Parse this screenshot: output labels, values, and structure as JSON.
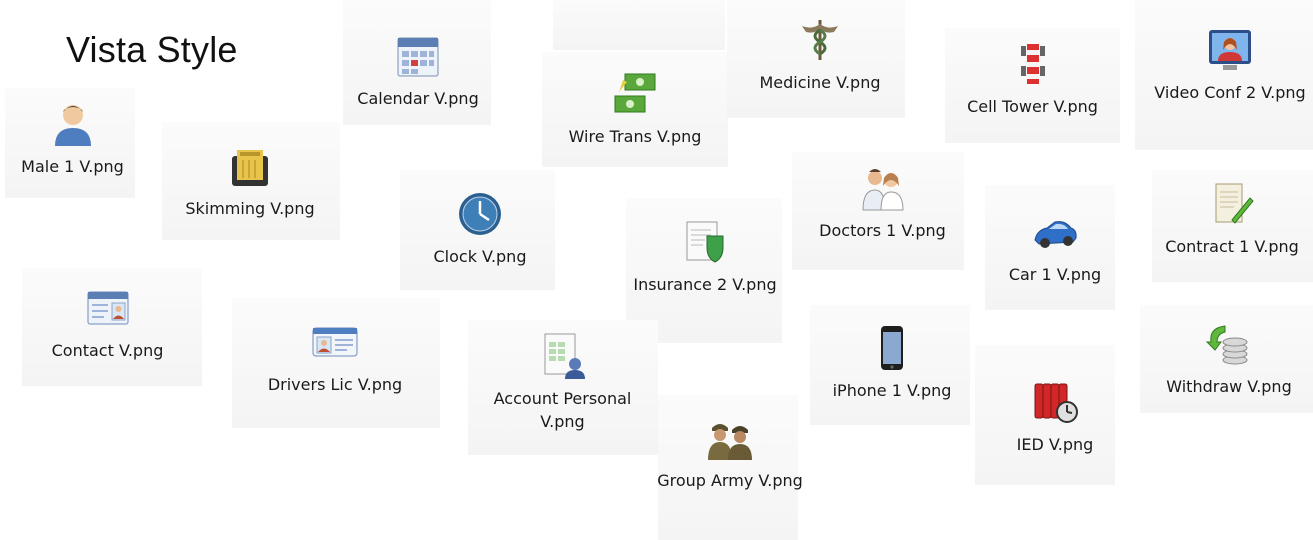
{
  "page": {
    "title": "Vista Style"
  },
  "icons": [
    {
      "label": "Male 1 V.png",
      "icon": "male-user-icon"
    },
    {
      "label": "Skimming V.png",
      "icon": "skimming-device-icon"
    },
    {
      "label": "Calendar V.png",
      "icon": "calendar-icon"
    },
    {
      "label": "Clock V.png",
      "icon": "clock-icon"
    },
    {
      "label": "Wire Trans V.png",
      "icon": "wire-transfer-icon"
    },
    {
      "label": "Insurance 2 V.png",
      "icon": "insurance-shield-icon"
    },
    {
      "label": "Medicine V.png",
      "icon": "caduceus-icon"
    },
    {
      "label": "Doctors 1 V.png",
      "icon": "doctors-icon"
    },
    {
      "label": "Cell Tower V.png",
      "icon": "cell-tower-icon"
    },
    {
      "label": "Car 1 V.png",
      "icon": "car-icon"
    },
    {
      "label": "Video Conf 2 V.png",
      "icon": "video-conference-icon"
    },
    {
      "label": "Contract 1 V.png",
      "icon": "contract-icon"
    },
    {
      "label": "Contact V.png",
      "icon": "contact-card-icon"
    },
    {
      "label": "Drivers Lic V.png",
      "icon": "drivers-license-icon"
    },
    {
      "label": "Account Personal V.png",
      "icon": "account-personal-icon"
    },
    {
      "label": "Group Army V.png",
      "icon": "army-group-icon"
    },
    {
      "label": "iPhone 1 V.png",
      "icon": "iphone-icon"
    },
    {
      "label": "IED V.png",
      "icon": "ied-bomb-icon"
    },
    {
      "label": "Withdraw V.png",
      "icon": "withdraw-coins-icon"
    }
  ]
}
